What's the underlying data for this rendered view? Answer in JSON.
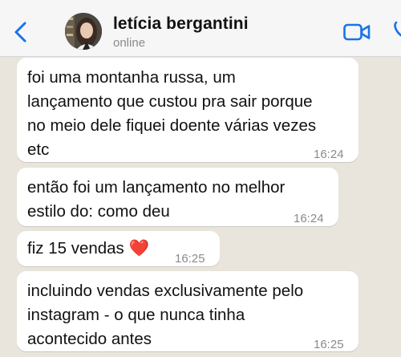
{
  "header": {
    "contact_name": "letícia bergantini",
    "status": "online",
    "back_icon": "chevron-left-icon",
    "video_icon": "video-camera-icon",
    "call_icon": "phone-icon",
    "accent_color": "#1a73e8"
  },
  "messages": [
    {
      "lines": [
        "foi uma montanha russa, um",
        "lançamento que custou pra sair porque",
        "no meio dele fiquei doente várias vezes",
        "etc"
      ],
      "time": "16:24"
    },
    {
      "lines": [
        "então foi um lançamento no melhor",
        "estilo do: como deu"
      ],
      "time": "16:24"
    },
    {
      "lines": [
        "fiz 15 vendas ❤️"
      ],
      "time": "16:25"
    },
    {
      "lines": [
        "incluindo vendas exclusivamente pelo",
        "instagram - o que nunca tinha",
        "acontecido antes"
      ],
      "time": "16:25"
    }
  ]
}
